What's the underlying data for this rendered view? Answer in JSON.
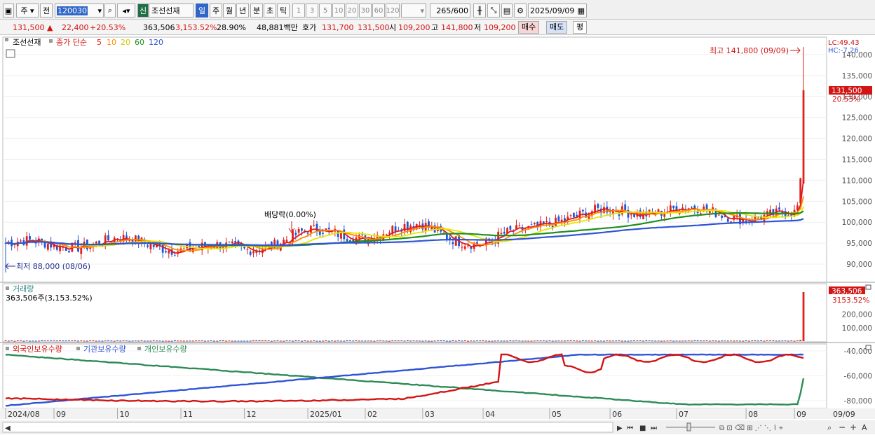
{
  "toolbar": {
    "market": "주",
    "prev_label": "전",
    "code": "120030",
    "new_badge": "신",
    "stock_name": "조선선재",
    "periods": [
      "일",
      "주",
      "월",
      "년",
      "분",
      "초",
      "틱"
    ],
    "intervals": [
      "1",
      "3",
      "5",
      "10",
      "20",
      "30",
      "60",
      "120"
    ],
    "count": "265",
    "count_total": "/600",
    "date": "2025/09/09"
  },
  "info": {
    "price": "131,500",
    "change": "22,400",
    "change_pct": "+20.53%",
    "volume": "363,506",
    "vol_ratio": "3,153.52%",
    "turnover": "28.90%",
    "amount": "48,881백만",
    "quote_label": "호가",
    "ask": "131,700",
    "bid": "131,500",
    "open_label": "시",
    "open": "109,200",
    "high_label": "고",
    "high": "141,800",
    "low_label": "저",
    "low": "109,200",
    "buy_label": "매수",
    "sell_label": "매도",
    "avg_label": "평"
  },
  "price_panel": {
    "legend_name": "조선선재",
    "legend_close": "종가 단순",
    "ma_labels": [
      "5",
      "10",
      "20",
      "60",
      "120"
    ],
    "ma_colors": [
      "#e31a1c",
      "#ff8c00",
      "#e6e600",
      "#1f8f1f",
      "#2f55d4"
    ],
    "lc": "LC:49.43",
    "hc": "HC:-7.26",
    "max_note": "최고 141,800 (09/09)",
    "min_note": "최저 88,000 (08/06)",
    "dividend_note": "배당락(0.00%)",
    "current_price": "131,500",
    "current_pct": "20.53%",
    "y_ticks": [
      "140,000",
      "135,000",
      "130,000",
      "125,000",
      "120,000",
      "115,000",
      "110,000",
      "105,000",
      "100,000",
      "95,000",
      "90,000"
    ]
  },
  "volume_panel": {
    "title": "거래량",
    "subtitle": "363,506주(3,153.52%)",
    "current": "363,506",
    "current_pct": "3153.52%",
    "y_ticks": [
      "200,000",
      "100,000"
    ]
  },
  "holdings_panel": {
    "legend": [
      "외국인보유수량",
      "기관보유수량",
      "개인보유수량"
    ],
    "legend_colors": [
      "#d21414",
      "#2f55d4",
      "#2e8b57"
    ],
    "y_ticks": [
      "-40,000",
      "-60,000",
      "-80,000"
    ]
  },
  "x_axis": {
    "labels": [
      "2024/08",
      "09",
      "10",
      "11",
      "12",
      "2025/01",
      "02",
      "03",
      "04",
      "05",
      "06",
      "07",
      "08",
      "09"
    ],
    "right_label": "09/09"
  },
  "chart_data": {
    "type": "candlestick",
    "date_range": [
      "2024/08/06",
      "2025/09/09"
    ],
    "bars": 265,
    "ylim": [
      87000,
      143000
    ],
    "current": 131500,
    "high": 141800,
    "low": 88000,
    "monthly_close": [
      {
        "m": "2024/08",
        "close": 95000
      },
      {
        "m": "2024/09",
        "close": 94500
      },
      {
        "m": "2024/10",
        "close": 95500
      },
      {
        "m": "2024/11",
        "close": 94000
      },
      {
        "m": "2024/12",
        "close": 93500
      },
      {
        "m": "2025/01",
        "close": 97500
      },
      {
        "m": "2025/02",
        "close": 97000
      },
      {
        "m": "2025/03",
        "close": 99000
      },
      {
        "m": "2025/04",
        "close": 94500
      },
      {
        "m": "2025/05",
        "close": 100500
      },
      {
        "m": "2025/06",
        "close": 102500
      },
      {
        "m": "2025/07",
        "close": 103000
      },
      {
        "m": "2025/08",
        "close": 101500
      },
      {
        "m": "2025/09",
        "close": 131500
      }
    ]
  }
}
